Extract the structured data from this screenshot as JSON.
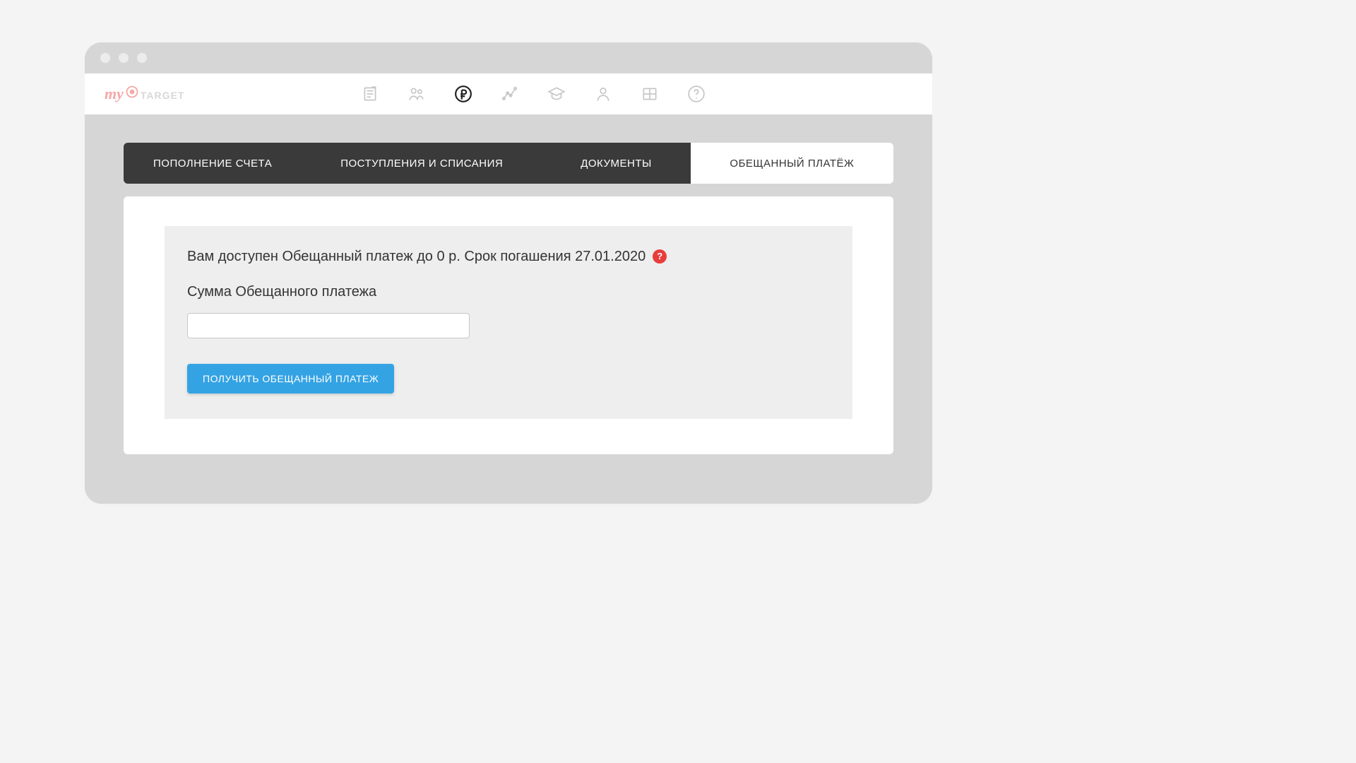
{
  "logo": {
    "script": "my",
    "tail": "TARGET"
  },
  "nav": {
    "items": [
      {
        "name": "campaigns-icon"
      },
      {
        "name": "audiences-icon"
      },
      {
        "name": "billing-icon",
        "active": true
      },
      {
        "name": "stats-icon"
      },
      {
        "name": "education-icon"
      },
      {
        "name": "profile-icon"
      },
      {
        "name": "apps-icon"
      },
      {
        "name": "help-icon"
      }
    ]
  },
  "tabs": [
    {
      "label": "ПОПОЛНЕНИЕ СЧЕТА"
    },
    {
      "label": "ПОСТУПЛЕНИЯ И СПИСАНИЯ"
    },
    {
      "label": "ДОКУМЕНТЫ"
    },
    {
      "label": "ОБЕЩАННЫЙ ПЛАТЁЖ",
      "active": true
    }
  ],
  "promised": {
    "info": "Вам доступен Обещанный платеж до 0 р. Срок погашения 27.01.2020",
    "help_symbol": "?",
    "field_label": "Сумма Обещанного платежа",
    "button": "ПОЛУЧИТЬ ОБЕЩАННЫЙ ПЛАТЕЖ"
  }
}
